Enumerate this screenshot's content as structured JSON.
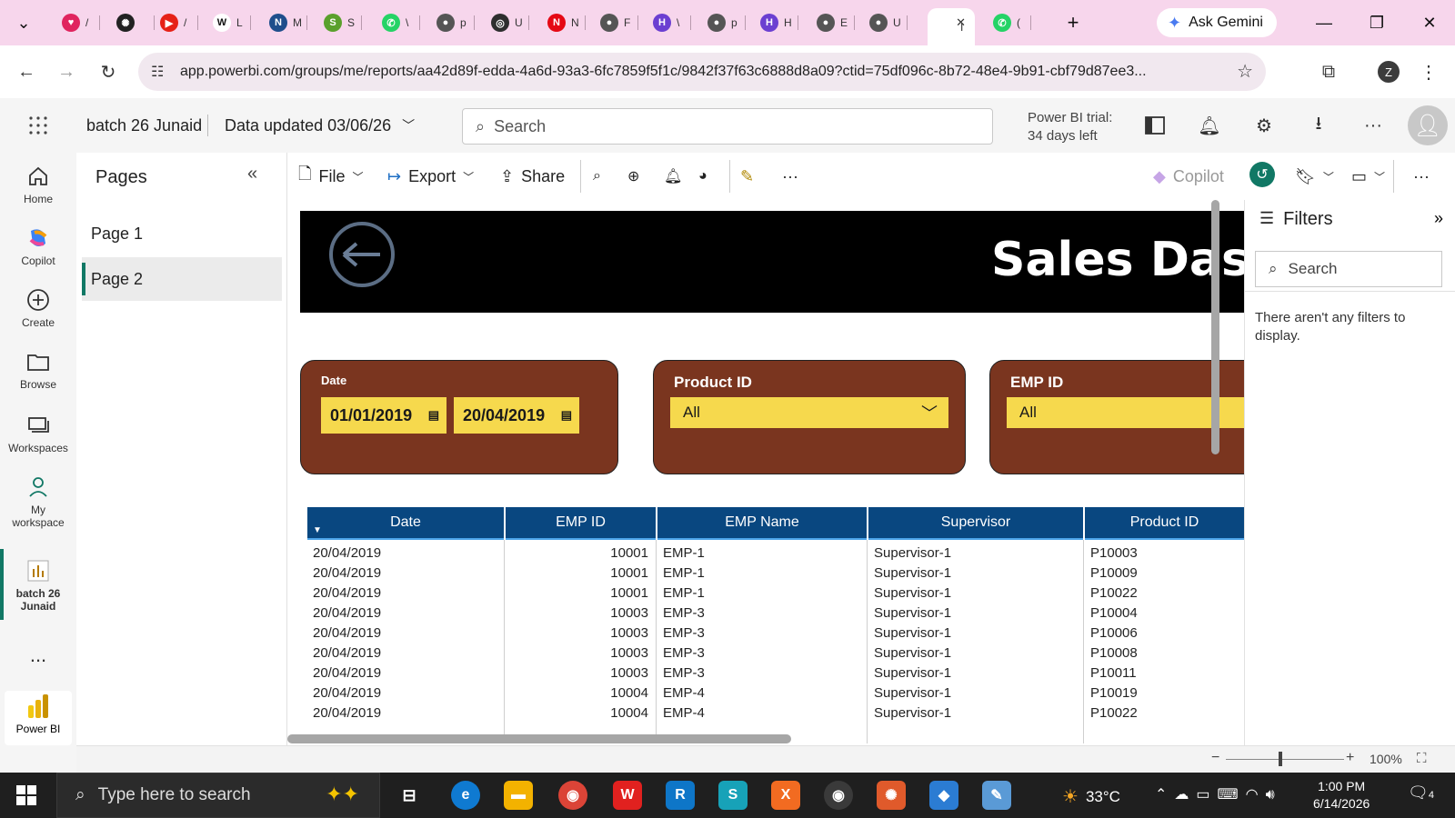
{
  "browser": {
    "tabs": [
      {
        "label": "/",
        "color": "#e0245e",
        "glyph": "♥"
      },
      {
        "label": "",
        "color": "#222222",
        "glyph": "✺"
      },
      {
        "label": "/",
        "color": "#e62117",
        "glyph": "▶"
      },
      {
        "label": "L",
        "color": "#ffffff",
        "glyph": "W"
      },
      {
        "label": "M",
        "color": "#1f4e8c",
        "glyph": "N"
      },
      {
        "label": "S",
        "color": "#5aa02c",
        "glyph": "S"
      },
      {
        "label": "\\",
        "color": "#25d366",
        "glyph": "✆"
      },
      {
        "label": "p",
        "color": "#555555",
        "glyph": "●"
      },
      {
        "label": "U",
        "color": "#2e2e2e",
        "glyph": "◎"
      },
      {
        "label": "N",
        "color": "#e50914",
        "glyph": "N"
      },
      {
        "label": "F",
        "color": "#555555",
        "glyph": "●"
      },
      {
        "label": "\\",
        "color": "#6b3fd1",
        "glyph": "H"
      },
      {
        "label": "p",
        "color": "#555555",
        "glyph": "●"
      },
      {
        "label": "H",
        "color": "#6b3fd1",
        "glyph": "H"
      },
      {
        "label": "E",
        "color": "#555555",
        "glyph": "●"
      },
      {
        "label": "U",
        "color": "#555555",
        "glyph": "●"
      },
      {
        "label": "I",
        "color": "#ffffff",
        "glyph": ""
      },
      {
        "label": "(",
        "color": "#25d366",
        "glyph": "✆"
      }
    ],
    "ask_gemini": "Ask Gemini",
    "url": "app.powerbi.com/groups/me/reports/aa42d89f-edda-4a6d-93a3-6fc7859f5f1c/9842f37f63c6888d8a09?ctid=75df096c-8b72-48e4-9b91-cbf79d87ee3...",
    "profile_initial": "Z"
  },
  "header": {
    "workspace": "batch 26 Junaid",
    "data_updated": "Data updated 03/06/26",
    "search_placeholder": "Search",
    "trial_line1": "Power BI trial:",
    "trial_line2": "34 days left"
  },
  "leftnav": {
    "items": [
      {
        "label": "Home"
      },
      {
        "label": "Copilot"
      },
      {
        "label": "Create"
      },
      {
        "label": "Browse"
      },
      {
        "label": "Workspaces"
      },
      {
        "label": "My\nworkspace"
      },
      {
        "label": "batch 26\nJunaid"
      }
    ],
    "more": "...",
    "app": "Power BI"
  },
  "pages": {
    "title": "Pages",
    "items": [
      "Page 1",
      "Page 2"
    ],
    "selected": "Page 2"
  },
  "toolbar": {
    "file": "File",
    "export": "Export",
    "share": "Share",
    "copilot": "Copilot"
  },
  "report": {
    "banner_title": "Sales Dashboard",
    "slicers": {
      "date": {
        "title": "Date",
        "start": "01/01/2019",
        "end": "20/04/2019"
      },
      "product": {
        "title": "Product ID",
        "value": "All"
      },
      "emp": {
        "title": "EMP ID",
        "value": "All"
      }
    },
    "table": {
      "columns": [
        "Date",
        "EMP ID",
        "EMP Name",
        "Supervisor",
        "Product ID"
      ],
      "rows": [
        [
          "20/04/2019",
          "10001",
          "EMP-1",
          "Supervisor-1",
          "P10003"
        ],
        [
          "20/04/2019",
          "10001",
          "EMP-1",
          "Supervisor-1",
          "P10009"
        ],
        [
          "20/04/2019",
          "10001",
          "EMP-1",
          "Supervisor-1",
          "P10022"
        ],
        [
          "20/04/2019",
          "10003",
          "EMP-3",
          "Supervisor-1",
          "P10004"
        ],
        [
          "20/04/2019",
          "10003",
          "EMP-3",
          "Supervisor-1",
          "P10006"
        ],
        [
          "20/04/2019",
          "10003",
          "EMP-3",
          "Supervisor-1",
          "P10008"
        ],
        [
          "20/04/2019",
          "10003",
          "EMP-3",
          "Supervisor-1",
          "P10011"
        ],
        [
          "20/04/2019",
          "10004",
          "EMP-4",
          "Supervisor-1",
          "P10019"
        ],
        [
          "20/04/2019",
          "10004",
          "EMP-4",
          "Supervisor-1",
          "P10022"
        ]
      ]
    }
  },
  "filters": {
    "title": "Filters",
    "search_placeholder": "Search",
    "empty": "There aren't any filters to display."
  },
  "status": {
    "zoom": "100%"
  },
  "taskbar": {
    "search_placeholder": "Type here to search",
    "weather": "33°C",
    "time": "1:00 PM",
    "date": "6/14/2026",
    "notif_count": "4"
  },
  "colors": {
    "slicer_bg": "#7a351f",
    "slicer_field": "#f6d94d",
    "table_header": "#094780",
    "accent": "#117865"
  }
}
